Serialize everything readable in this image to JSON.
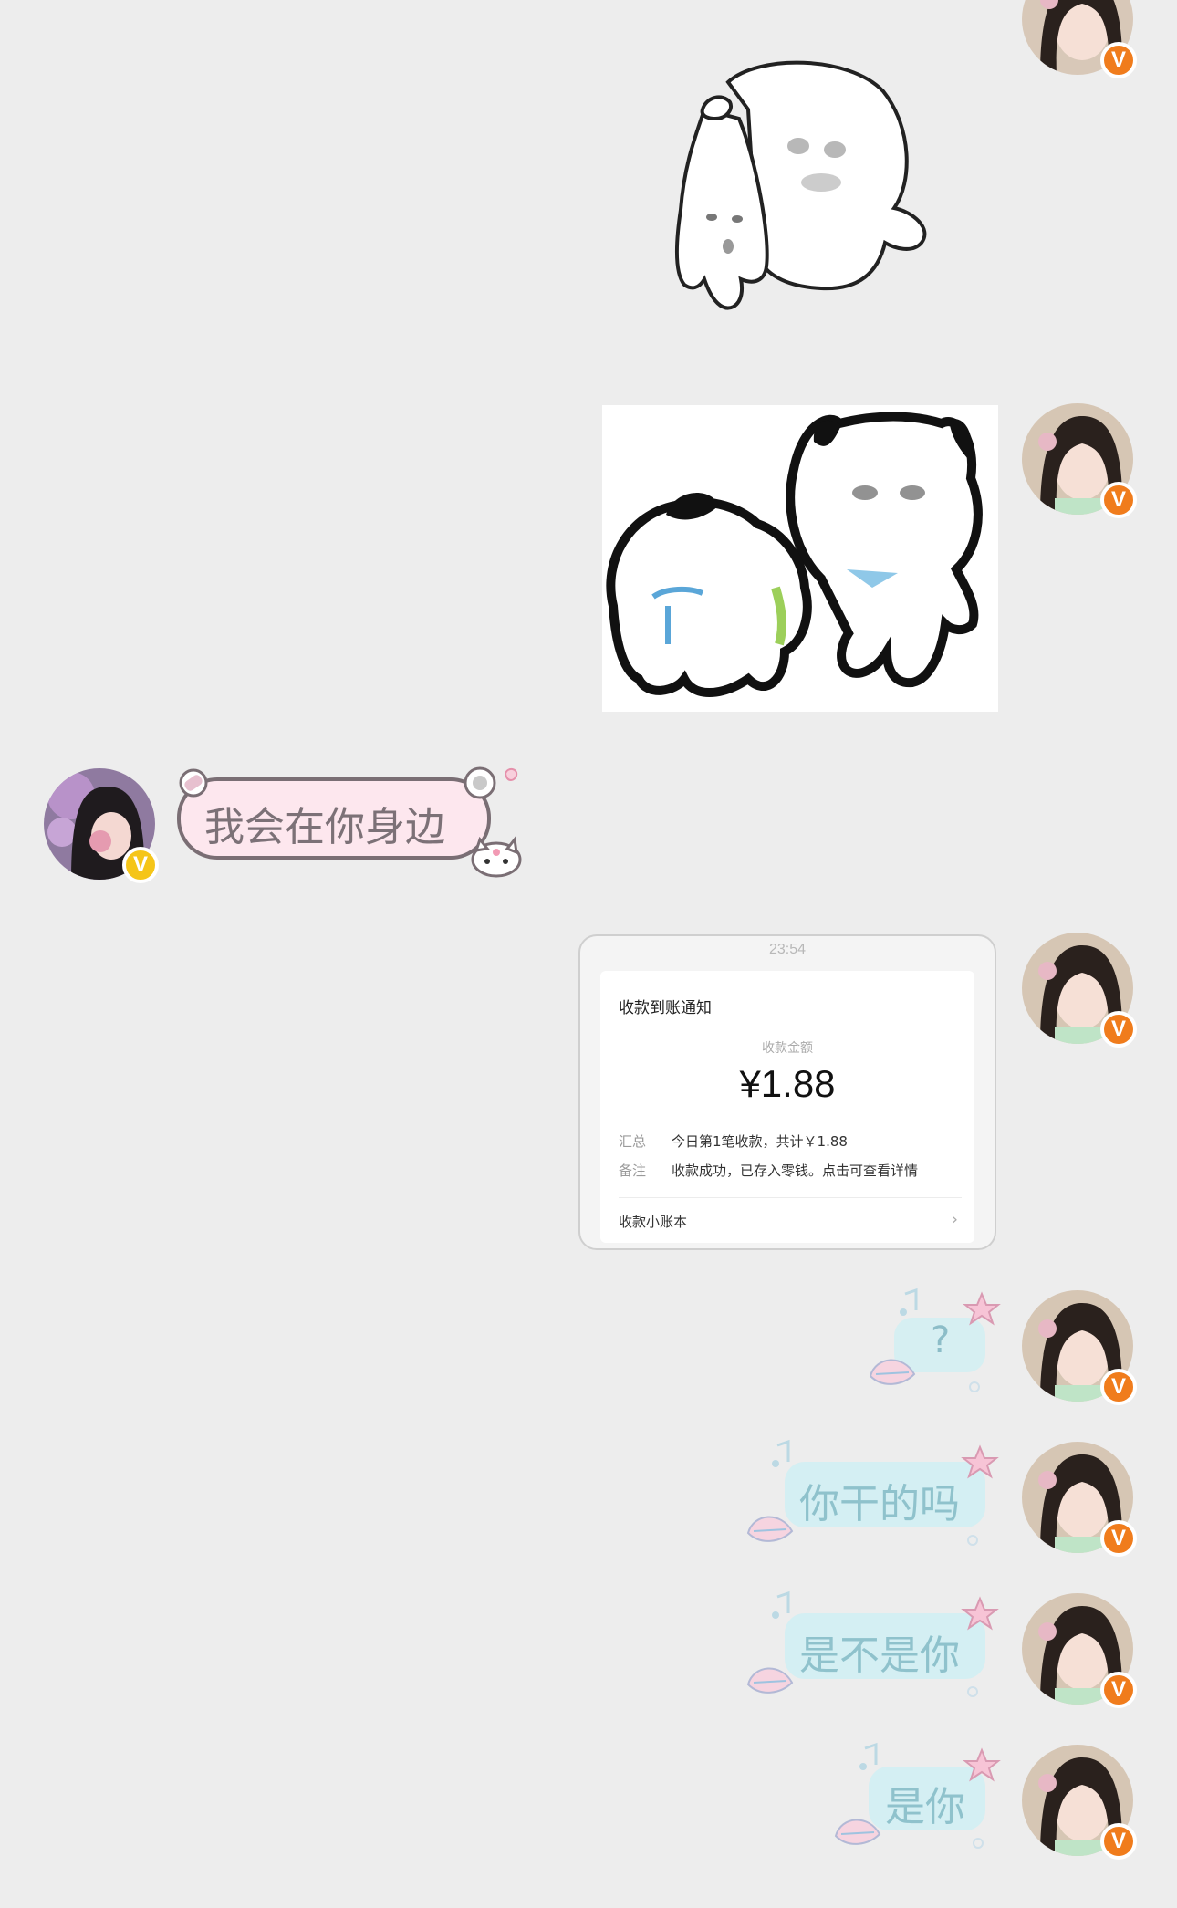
{
  "messages": {
    "left_text": "我会在你身边",
    "q": "?",
    "m1": "你干的吗",
    "m2": "是不是你",
    "m3": "是你"
  },
  "receipt": {
    "time": "23:54",
    "title": "收款到账通知",
    "amount_label": "收款金额",
    "amount": "¥1.88",
    "summary_key": "汇总",
    "summary_value": "今日第1笔收款，共计￥1.88",
    "note_key": "备注",
    "note_value": "收款成功，已存入零钱。点击可查看详情",
    "footer": "收款小账本",
    "chevron": "›"
  },
  "badges": {
    "verified_label": "V",
    "self_color": "#f07c1c",
    "other_color": "#f5c518"
  },
  "colors": {
    "background": "#ededed",
    "left_bubble_fill": "#fde7ee",
    "right_bubble_fill": "#cfeff3"
  }
}
